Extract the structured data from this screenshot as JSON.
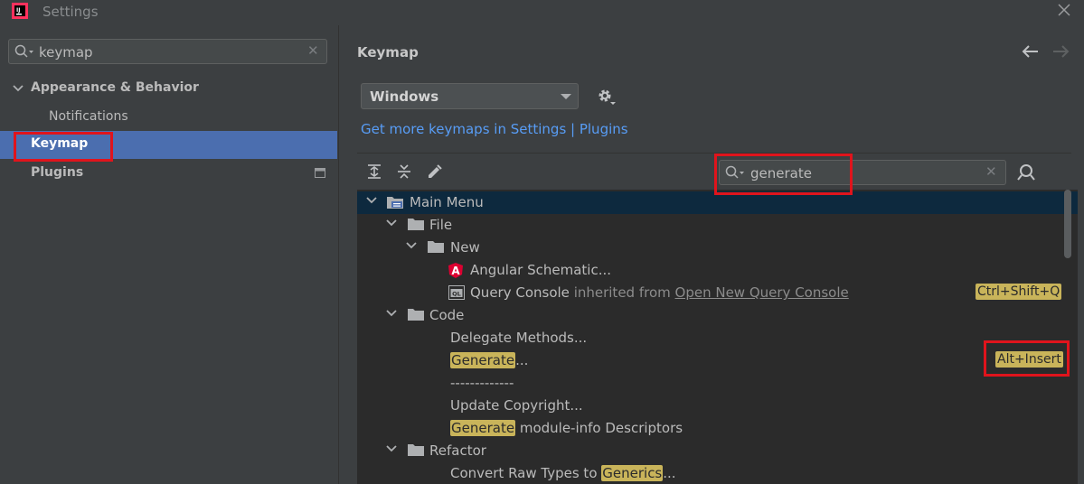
{
  "window": {
    "title": "Settings"
  },
  "sidebar": {
    "search_value": "keymap",
    "items": [
      {
        "label": "Appearance & Behavior"
      },
      {
        "label": "Notifications"
      },
      {
        "label": "Keymap"
      },
      {
        "label": "Plugins"
      }
    ]
  },
  "panel": {
    "title": "Keymap",
    "keymap_selected": "Windows",
    "link_text": "Get more keymaps in Settings | Plugins",
    "search_value": "generate"
  },
  "tree": {
    "main_menu": "Main Menu",
    "file": "File",
    "new": "New",
    "angular": "Angular Schematic...",
    "query_console": "Query Console",
    "inherited_from": "inherited from",
    "open_new_query_console": "Open New Query Console",
    "query_shortcut": "Ctrl+Shift+Q",
    "code": "Code",
    "delegate": "Delegate Methods...",
    "generate_hl": "Generate",
    "generate_rest": "...",
    "generate_shortcut": "Alt+Insert",
    "separator_line": "-------------",
    "update_copyright": "Update Copyright...",
    "module_hl": "Generate",
    "module_rest": " module-info Descriptors",
    "refactor": "Refactor",
    "convert_prefix": "Convert Raw Types to ",
    "convert_hl": "Generics",
    "convert_rest": "..."
  },
  "colors": {
    "background": "#3c3f41",
    "tree_background": "#2b2b2b",
    "selection": "#4b6eaf",
    "highlight": "#c9b45a",
    "link": "#589df6",
    "annotation_red": "#e0141c"
  }
}
